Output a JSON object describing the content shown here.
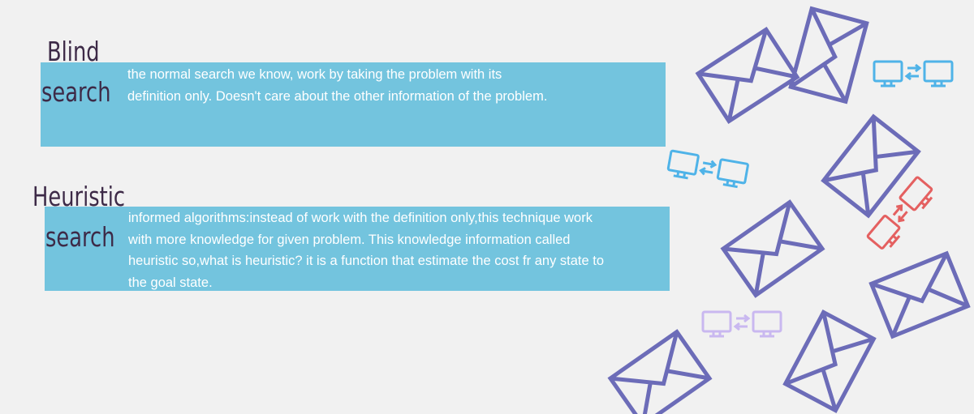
{
  "blind": {
    "title_line1": "Blind",
    "title_line2": "search",
    "text": " the normal search we know, work by taking the problem with its definition only. Doesn't care about the other information of the problem."
  },
  "heuristic": {
    "title_line1": "Heuristic",
    "title_line2": "search",
    "text": "informed algorithms:instead of work with the definition only,this technique work with more knowledge for given problem. This knowledge information called heuristic so,what is heuristic? it is a function that estimate the cost fr any state to the goal state."
  },
  "colors": {
    "bar": "#73c4de",
    "title": "#3d2a47",
    "envelope": "#6c6cb8",
    "computer_blue": "#4fb3e8",
    "computer_red": "#e46060",
    "computer_purple": "#c9b8f0"
  },
  "decorations": {
    "envelope_icon_count": 7,
    "computer_pair_icons": [
      "computer-pair-blue",
      "computer-pair-blue",
      "computer-pair-red",
      "computer-pair-purple"
    ]
  }
}
